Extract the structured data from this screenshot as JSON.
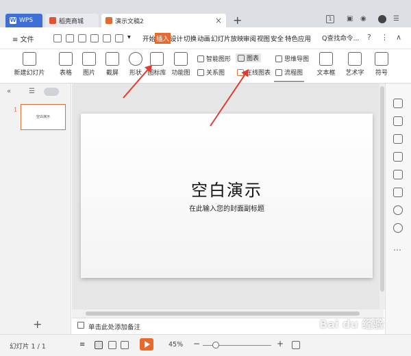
{
  "tabs": [
    {
      "label": "WPS"
    },
    {
      "label": "稻壳商城"
    },
    {
      "label": "演示文稿2"
    }
  ],
  "titlebar": {
    "badge": "1"
  },
  "menu": {
    "file": "≡ 文件",
    "items": [
      "开始",
      "插入",
      "设计",
      "切换",
      "动画",
      "幻灯片放映",
      "审阅",
      "视图",
      "安全",
      "特色应用"
    ],
    "active_index": 1,
    "search": "Q查找命令..."
  },
  "ribbon": {
    "new_slide": "新建幻灯片",
    "table": "表格",
    "image": "图片",
    "screenshot": "截屏",
    "shape": "形状",
    "iconlib": "图标库",
    "funcmap": "功能图",
    "smart_graphic": "智能图形",
    "chart": "图表",
    "relation": "关系图",
    "online_chart": "在线图表",
    "mindmap": "思维导图",
    "flowchart": "流程图",
    "textbox": "文本框",
    "wordart": "艺术字",
    "symbol": "符号"
  },
  "slide": {
    "title": "空白演示",
    "subtitle": "在此输入您的封面副标题",
    "thumb_number": "1",
    "thumb_title": "空白演示"
  },
  "notes": {
    "placeholder": "单击此处添加备注"
  },
  "status": {
    "slide_count": "幻灯片 1 / 1",
    "zoom": "45%"
  },
  "watermark": "Bai du 经验",
  "colors": {
    "accent": "#e8692d",
    "wps_blue": "#3f6fd6",
    "arrow": "#e23a2e"
  }
}
